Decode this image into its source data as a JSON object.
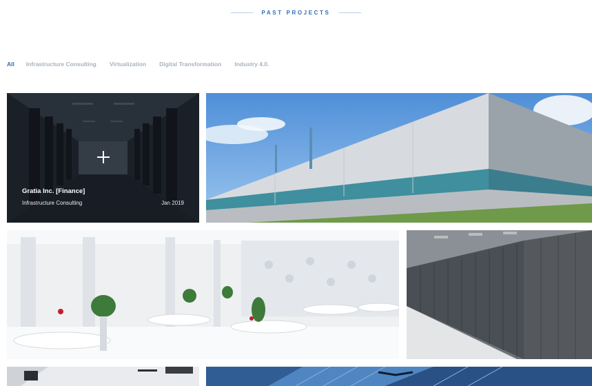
{
  "section": {
    "title": "PAST PROJECTS"
  },
  "filters": [
    {
      "label": "All",
      "active": true
    },
    {
      "label": "Infrastructure Consulting",
      "active": false
    },
    {
      "label": "Virtualization",
      "active": false
    },
    {
      "label": "Digital Transformation",
      "active": false
    },
    {
      "label": "Industry 4.0.",
      "active": false
    }
  ],
  "projects": [
    {
      "title": "Gratia Inc. [Finance]",
      "category": "Infrastructure Consulting",
      "date": "Jan 2019"
    }
  ],
  "colors": {
    "accent": "#2f6fb5",
    "muted": "#a9b2bd",
    "divider": "#b7cde6"
  }
}
